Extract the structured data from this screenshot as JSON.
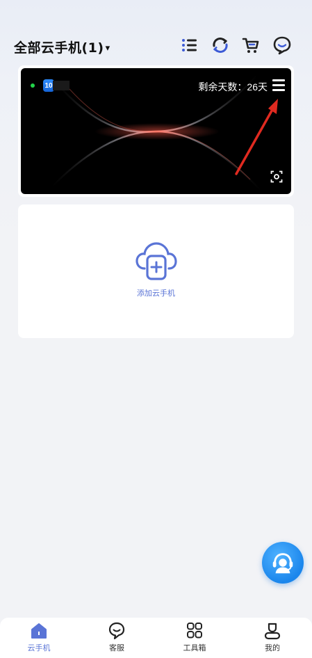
{
  "header": {
    "title": "全部云手机(1)",
    "caret": "▾",
    "icons": [
      "list-icon",
      "refresh-icon",
      "cart-icon",
      "message-icon"
    ]
  },
  "phone": {
    "os_badge": "10",
    "remaining_days": "剩余天数：26天",
    "status_color": "#22d34a"
  },
  "add": {
    "label": "添加云手机",
    "accent_color": "#5a74d6"
  },
  "tabs": [
    {
      "label": "云手机",
      "icon": "cloud-phone-home-icon",
      "active": true
    },
    {
      "label": "客服",
      "icon": "customer-service-icon",
      "active": false
    },
    {
      "label": "工具箱",
      "icon": "toolbox-grid-icon",
      "active": false
    },
    {
      "label": "我的",
      "icon": "profile-icon",
      "active": false
    }
  ],
  "fab": {
    "icon": "headset-agent-icon"
  }
}
